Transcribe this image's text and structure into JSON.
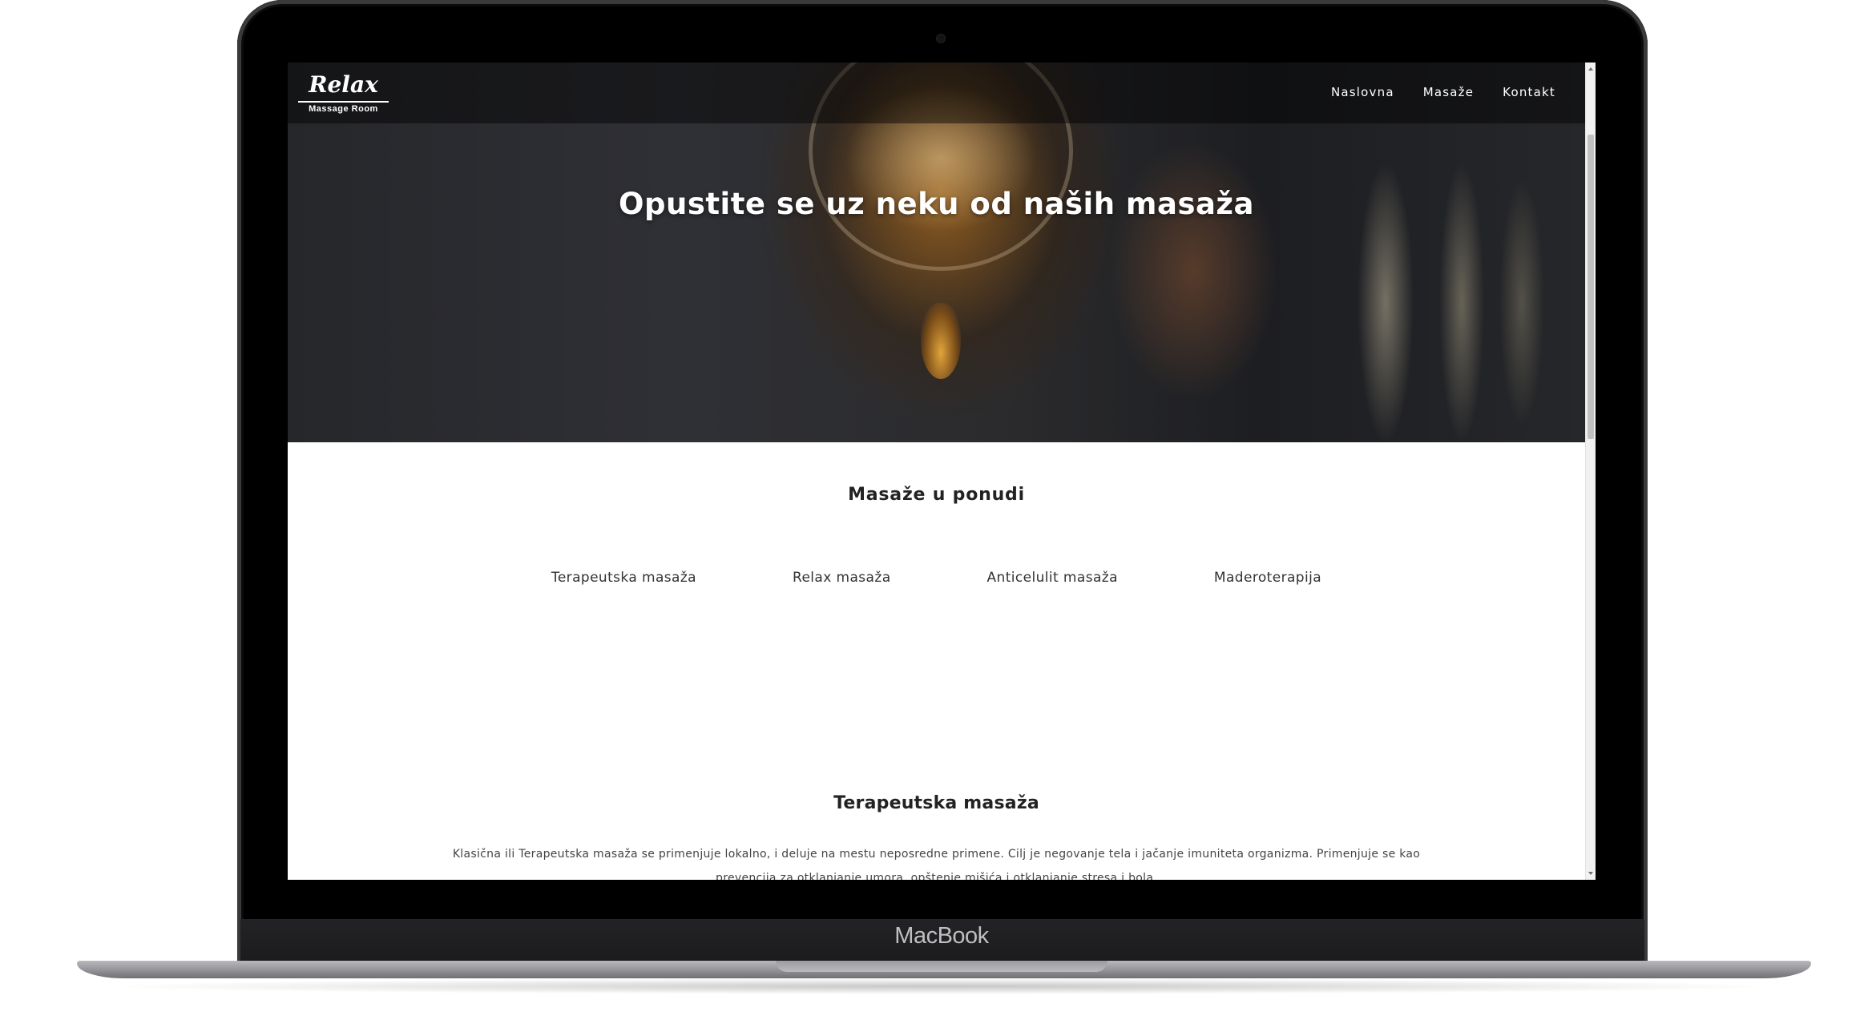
{
  "device": {
    "brand": "MacBook"
  },
  "site": {
    "logo": {
      "script": "Relax",
      "subtitle": "Massage Room"
    },
    "nav": [
      {
        "label": "Naslovna"
      },
      {
        "label": "Masaže"
      },
      {
        "label": "Kontakt"
      }
    ]
  },
  "hero": {
    "title": "Opustite se uz neku od naših masaža"
  },
  "offer": {
    "title": "Masaže u ponudi",
    "tabs": [
      {
        "label": "Terapeutska masaža"
      },
      {
        "label": "Relax masaža"
      },
      {
        "label": "Anticelulit masaža"
      },
      {
        "label": "Maderoterapija"
      }
    ]
  },
  "detail": {
    "title": "Terapeutska masaža",
    "text": "Klasična ili Terapeutska masaža se primenjuje lokalno, i deluje na mestu neposredne primene. Cilj je negovanje tela i jačanje imuniteta organizma. Primenjuje se kao prevencija za otklanjanje umora, opštenje mišića i otklanjanje stresa i bola."
  }
}
